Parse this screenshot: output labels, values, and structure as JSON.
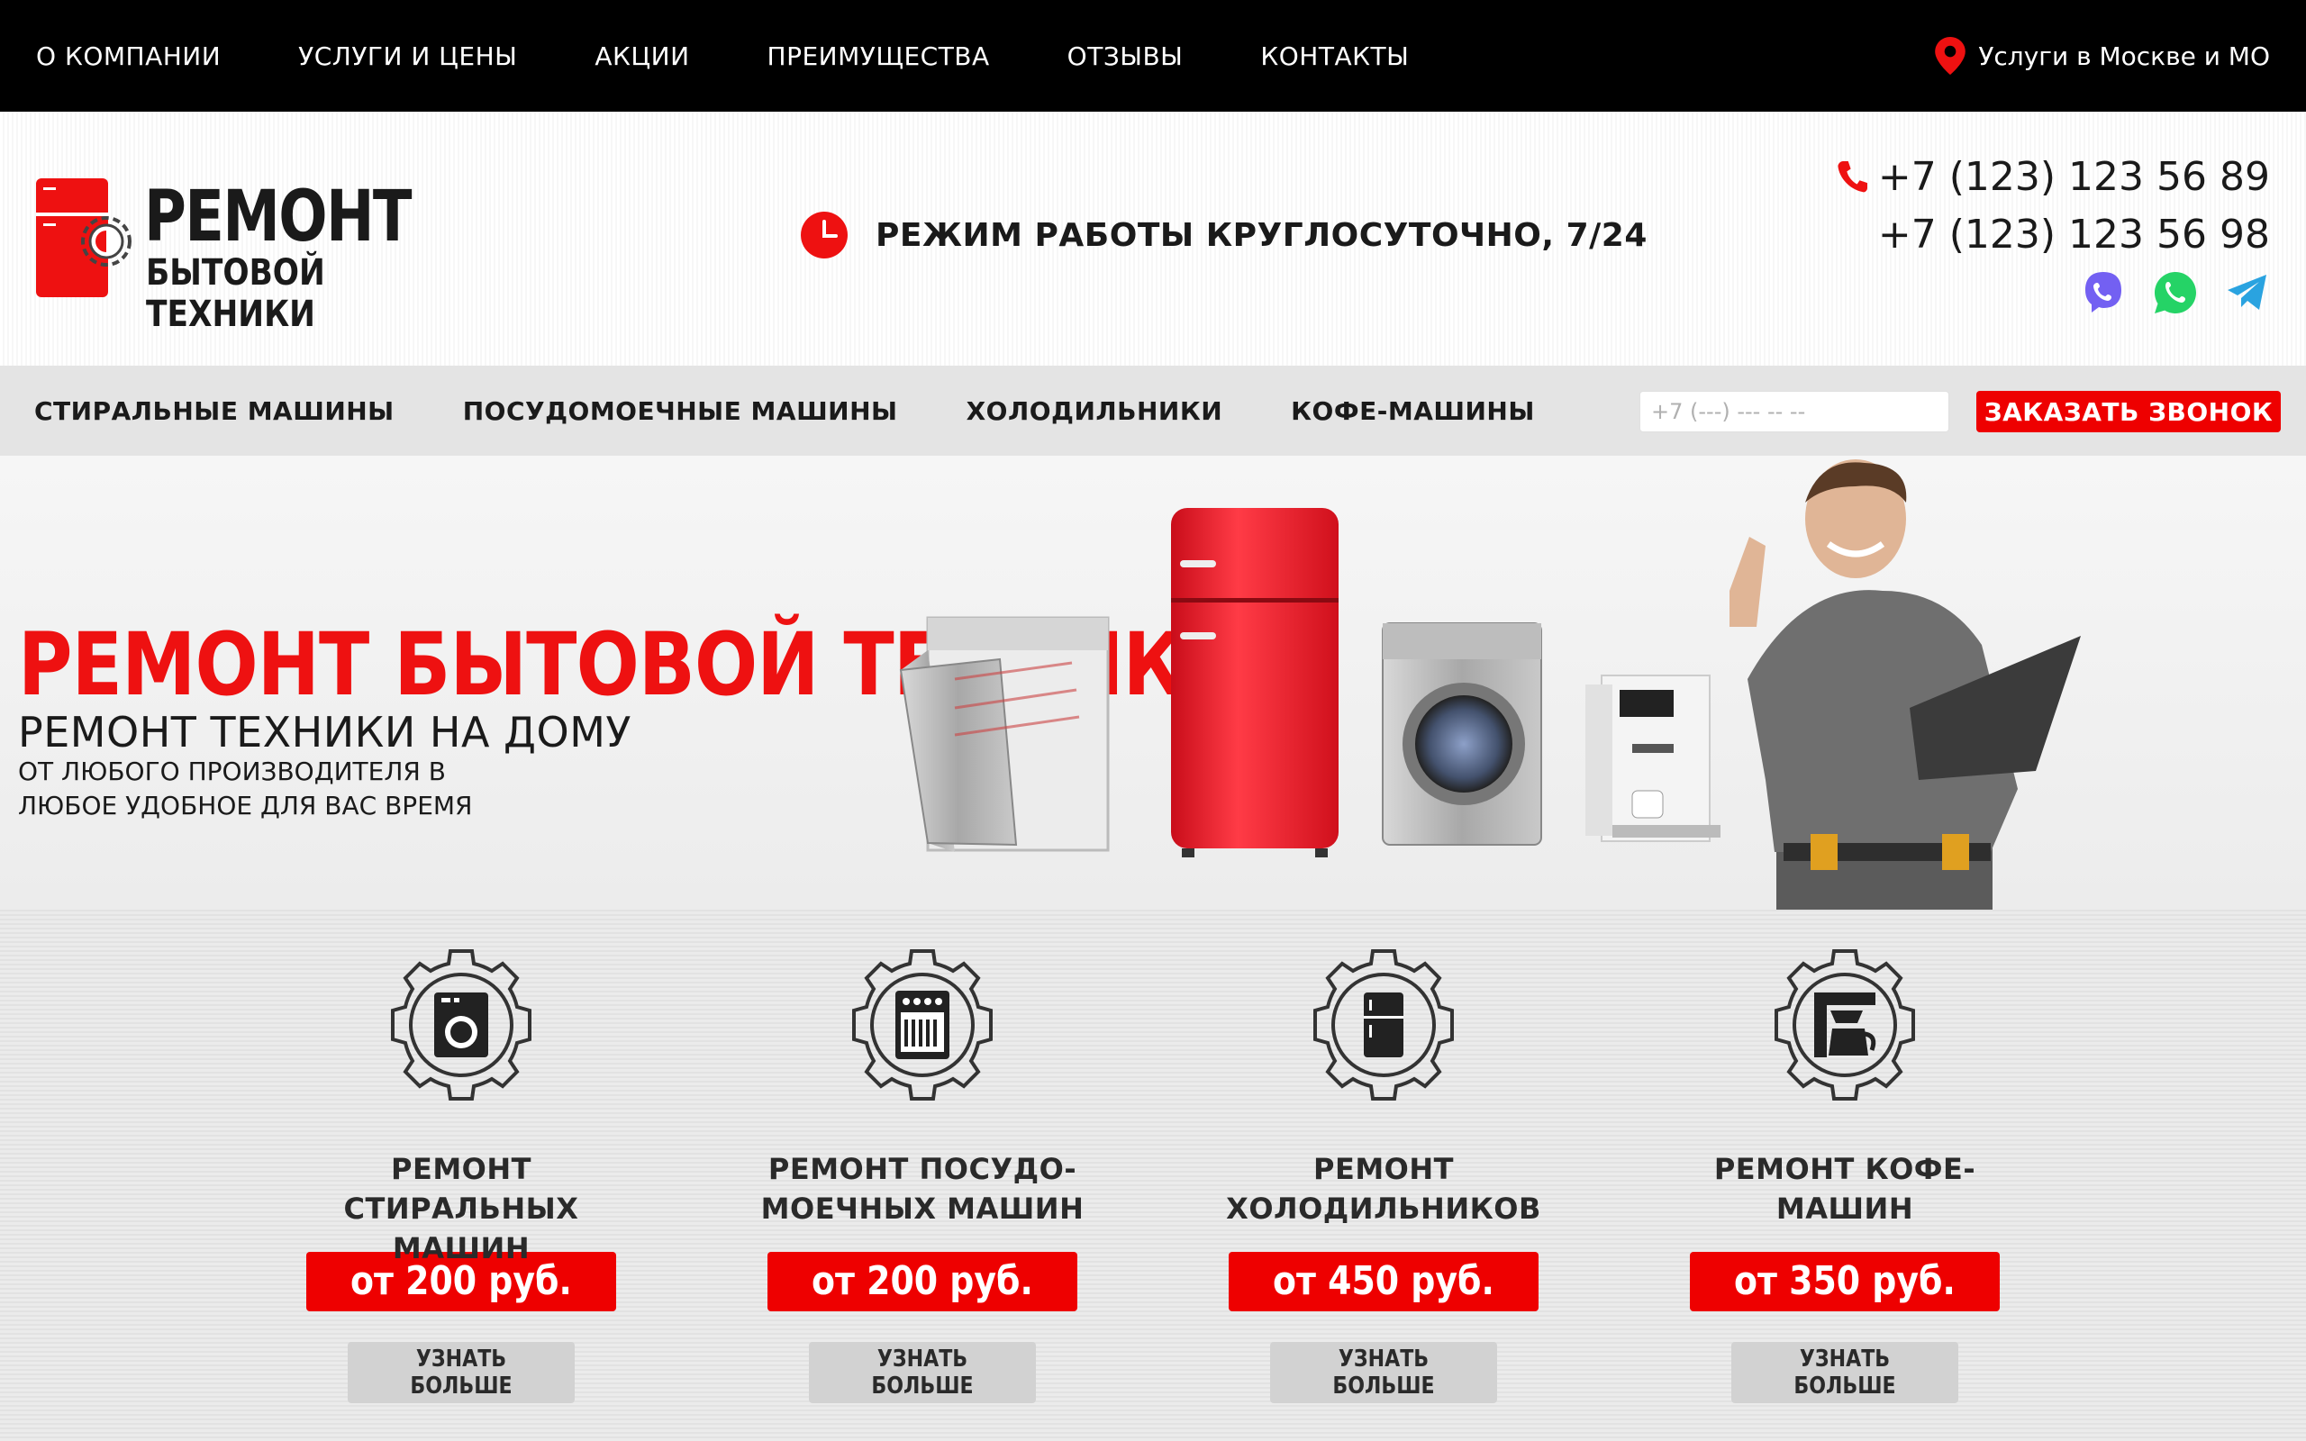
{
  "top_nav": {
    "items": [
      "О КОМПАНИИ",
      "УСЛУГИ И ЦЕНЫ",
      "АКЦИИ",
      "ПРЕИМУЩЕСТВА",
      "ОТЗЫВЫ",
      "КОНТАКТЫ"
    ],
    "region": "Услуги в Москве и МО"
  },
  "logo": {
    "line1": "РЕМОНТ",
    "line2": "БЫТОВОЙ ТЕХНИКИ"
  },
  "work_hours": "РЕЖИМ РАБОТЫ КРУГЛОСУТОЧНО, 7/24",
  "phones": [
    "+7 (123) 123 56 89",
    "+7 (123) 123 56 98"
  ],
  "messengers": [
    "viber-icon",
    "whatsapp-icon",
    "telegram-icon"
  ],
  "category_nav": {
    "items": [
      "СТИРАЛЬНЫЕ МАШИНЫ",
      "ПОСУДОМОЕЧНЫЕ МАШИНЫ",
      "ХОЛОДИЛЬНИКИ",
      "КОФЕ-МАШИНЫ"
    ],
    "phone_placeholder": "+7 (---) --- -- --",
    "call_button": "ЗАКАЗАТЬ ЗВОНОК"
  },
  "hero": {
    "title": "РЕМОНТ БЫТОВОЙ ТЕХНИКИ",
    "subtitle": "РЕМОНТ ТЕХНИКИ НА ДОМУ",
    "desc_line1": "ОТ ЛЮБОГО ПРОИЗВОДИТЕЛЯ В",
    "desc_line2": "ЛЮБОЕ УДОБНОЕ ДЛЯ ВАС ВРЕМЯ"
  },
  "services": [
    {
      "icon": "washing-machine-icon",
      "title": "РЕМОНТ СТИРАЛЬНЫХ\nМАШИН",
      "price": "от 200 руб.",
      "button": "УЗНАТЬ БОЛЬШЕ"
    },
    {
      "icon": "dishwasher-icon",
      "title": "РЕМОНТ ПОСУДО-\nМОЕЧНЫХ МАШИН",
      "price": "от 200 руб.",
      "button": "УЗНАТЬ БОЛЬШЕ"
    },
    {
      "icon": "fridge-icon",
      "title": "РЕМОНТ\nХОЛОДИЛЬНИКОВ",
      "price": "от 450 руб.",
      "button": "УЗНАТЬ БОЛЬШЕ"
    },
    {
      "icon": "coffee-machine-icon",
      "title": "РЕМОНТ КОФЕ-\nМАШИН",
      "price": "от 350 руб.",
      "button": "УЗНАТЬ БОЛЬШЕ"
    }
  ],
  "colors": {
    "accent": "#ee0000",
    "topbar": "#000000",
    "catbar": "#e4e4e4",
    "viber": "#7360f2",
    "whatsapp": "#25d366",
    "telegram": "#2aa3e0"
  }
}
